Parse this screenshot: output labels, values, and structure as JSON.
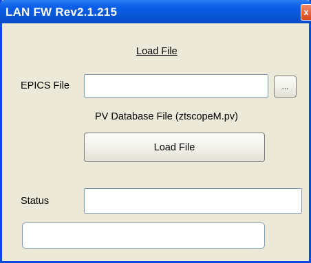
{
  "window": {
    "title": "LAN FW Rev2.1.215",
    "close_symbol": "x",
    "close_icon": "close-icon"
  },
  "load_section": {
    "heading": "Load File"
  },
  "epics": {
    "label": "EPICS File",
    "value": "",
    "browse_label": "...",
    "hint": "PV Database File (ztscopeM.pv)"
  },
  "load_button": {
    "label": "Load File"
  },
  "status": {
    "label": "Status",
    "value": "",
    "bottom_value": ""
  },
  "colors": {
    "titlebar": "#0a5ee8",
    "window_bg": "#ece9d8",
    "close": "#d8451e"
  }
}
